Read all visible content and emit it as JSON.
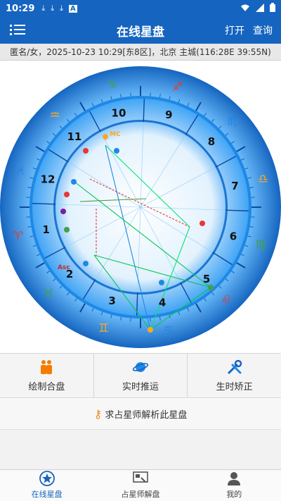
{
  "status_bar": {
    "time": "10:29",
    "left_icons": [
      "download-icon",
      "download-icon",
      "download-icon",
      "a-icon"
    ],
    "right_icons": [
      "wifi-icon",
      "signal-icon",
      "battery-icon"
    ]
  },
  "app_bar": {
    "title": "在线星盘",
    "open_label": "打开",
    "query_label": "查询",
    "color": "#1565c0"
  },
  "info": {
    "text": "匿名/女，2025-10-23 10:29[东8区]，北京 主城(116:28E 39:55N)"
  },
  "chart": {
    "houses": [
      "1",
      "2",
      "3",
      "4",
      "5",
      "6",
      "7",
      "8",
      "9",
      "10",
      "11",
      "12"
    ],
    "zodiac_signs": [
      "♈",
      "♉",
      "♊",
      "♋",
      "♌",
      "♍",
      "♎",
      "♏",
      "♐",
      "♑",
      "♒",
      "♓"
    ],
    "angle_labels": {
      "asc": "Asc",
      "mc": "MC"
    },
    "colors": {
      "ring_outer": "#1e88e5",
      "ring_inner": "#42a5f5",
      "center": "#ffffff"
    }
  },
  "actions": [
    {
      "label": "绘制合盘",
      "icon": "couple-icon"
    },
    {
      "label": "实时推运",
      "icon": "planet-icon"
    },
    {
      "label": "生时矫正",
      "icon": "tools-icon"
    }
  ],
  "ask": {
    "label": "求占星师解析此星盘",
    "icon": "key-icon"
  },
  "tabs": [
    {
      "label": "在线星盘",
      "icon": "star-icon",
      "active": true
    },
    {
      "label": "占星师解盘",
      "icon": "screen-icon",
      "active": false
    },
    {
      "label": "我的",
      "icon": "user-icon",
      "active": false
    }
  ]
}
